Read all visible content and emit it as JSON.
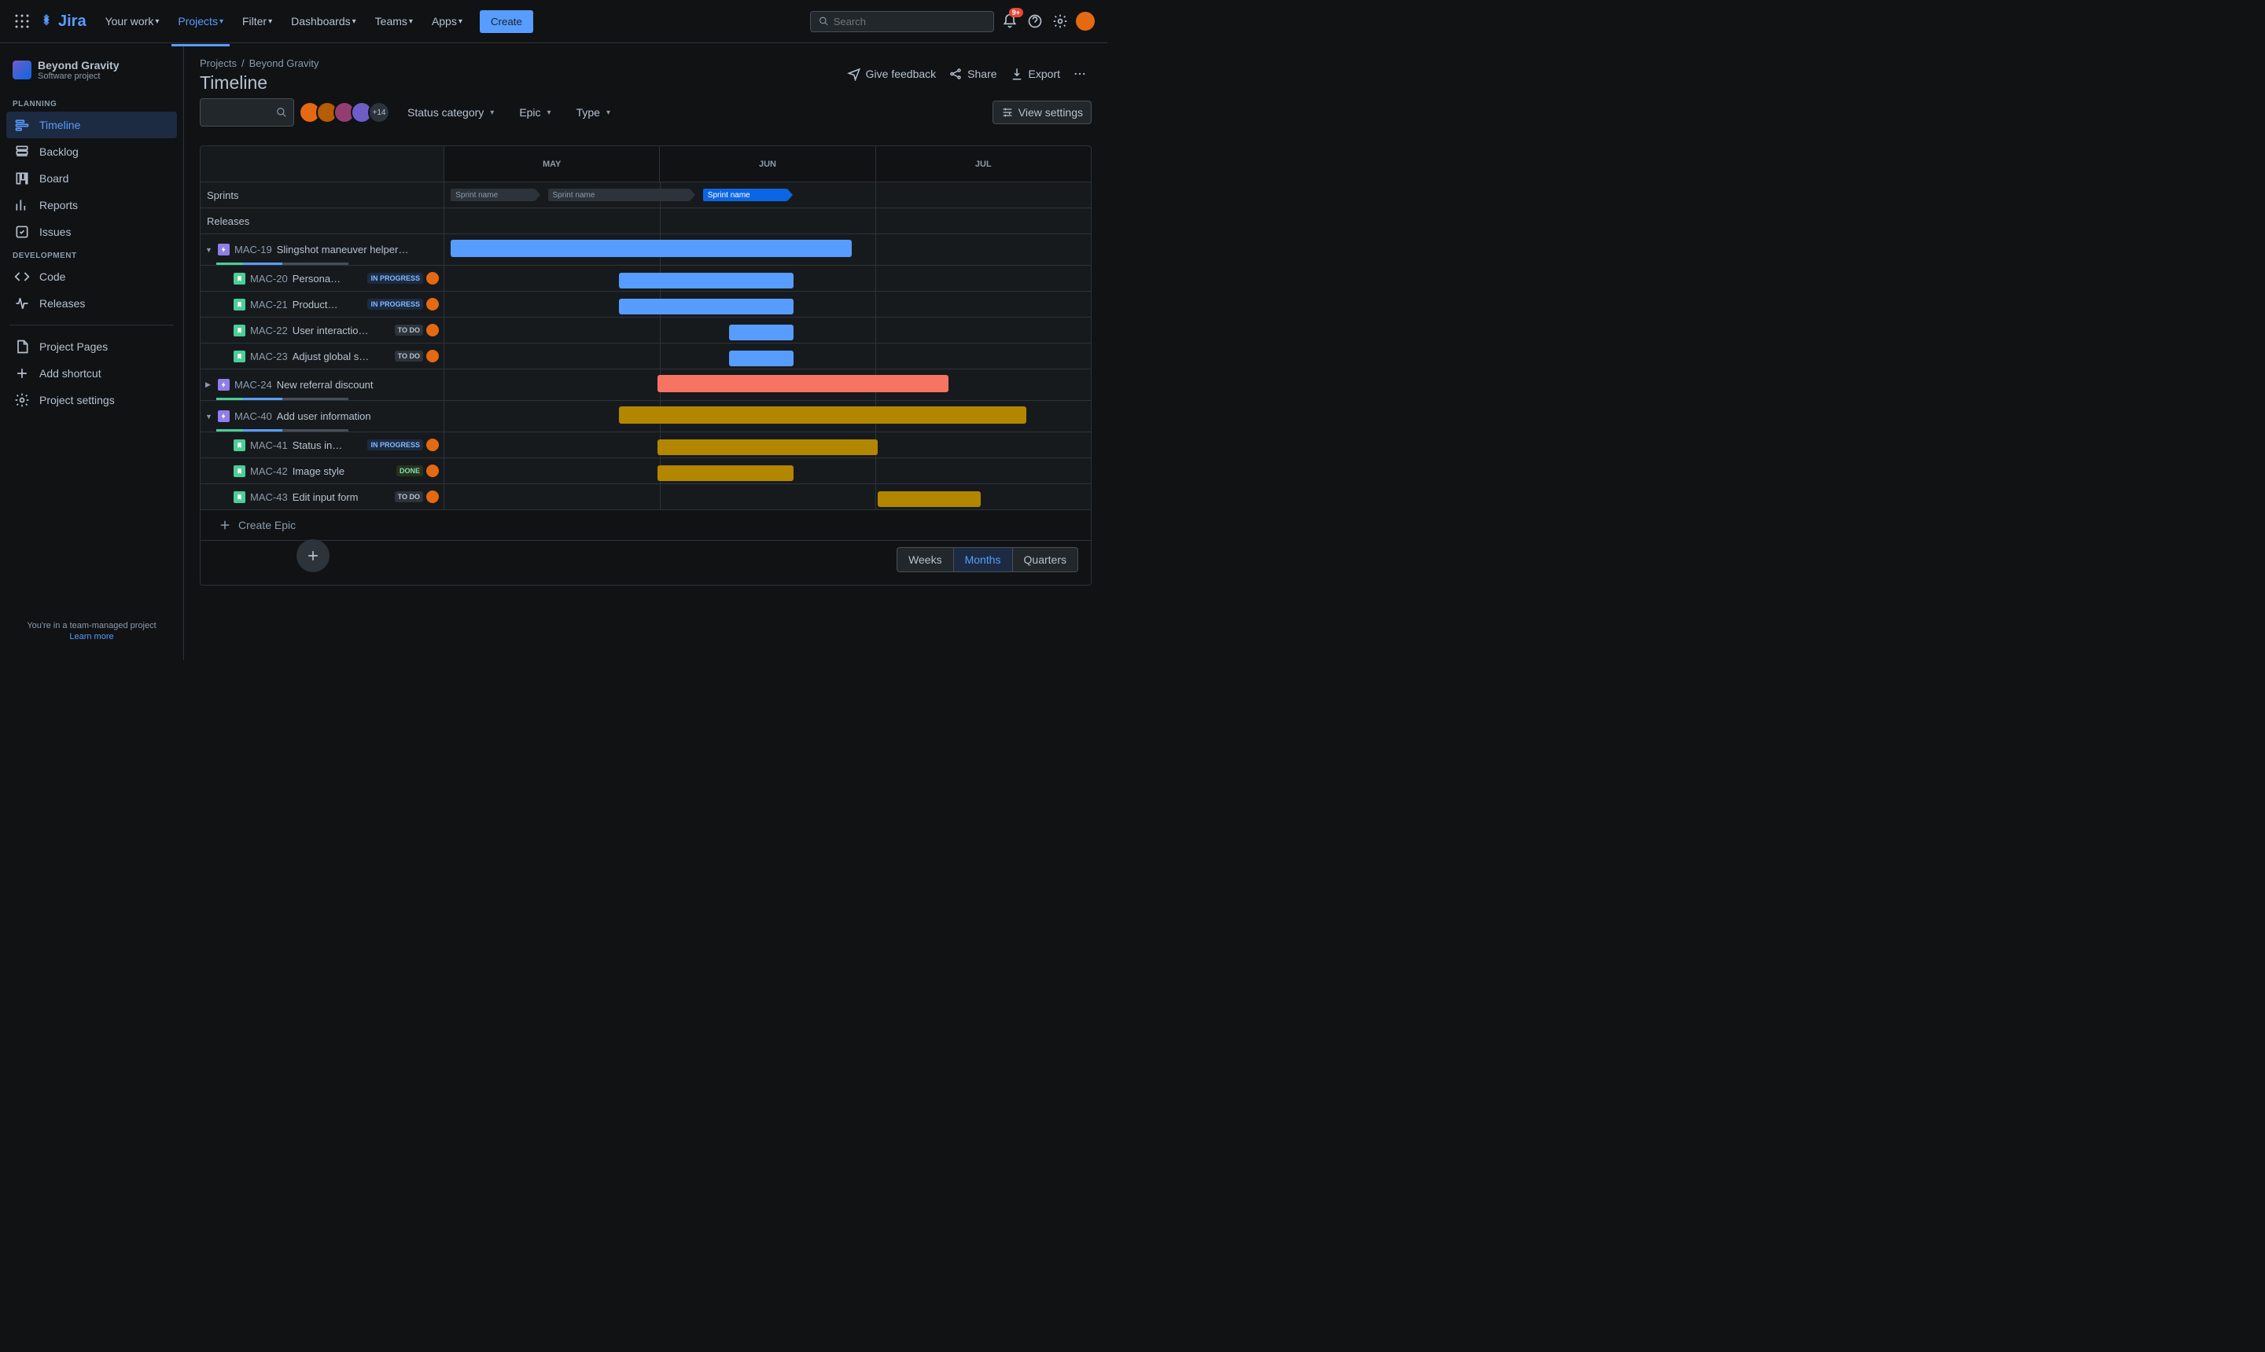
{
  "nav": {
    "items": [
      "Your work",
      "Projects",
      "Filter",
      "Dashboards",
      "Teams",
      "Apps"
    ],
    "create": "Create",
    "search_ph": "Search",
    "notif_badge": "9+"
  },
  "project": {
    "name": "Beyond Gravity",
    "subtitle": "Software project"
  },
  "sidebar": {
    "planning": "PLANNING",
    "planning_items": [
      "Timeline",
      "Backlog",
      "Board",
      "Reports",
      "Issues"
    ],
    "development": "DEVELOPMENT",
    "dev_items": [
      "Code",
      "Releases"
    ],
    "shortcuts": [
      "Project Pages",
      "Add shortcut",
      "Project settings"
    ],
    "footer": "You're in a team-managed project",
    "learn": "Learn more"
  },
  "breadcrumb": [
    "Projects",
    "Beyond Gravity"
  ],
  "title": "Timeline",
  "actions": {
    "feedback": "Give feedback",
    "share": "Share",
    "export": "Export"
  },
  "filters": {
    "status": "Status category",
    "epic": "Epic",
    "type": "Type",
    "more": "+14",
    "view": "View settings"
  },
  "months": [
    "MAY",
    "JUN",
    "JUL"
  ],
  "rows": {
    "sprints": "Sprints",
    "releases": "Releases"
  },
  "sprint_label": "Sprint name",
  "epics": [
    {
      "key": "MAC-19",
      "summary": "Slingshot maneuver helper…",
      "color": "b-blue",
      "barL": 1,
      "barW": 62,
      "children": [
        {
          "key": "MAC-20",
          "sum": "Persona…",
          "status": "IN PROGRESS",
          "st": "st-inprogress",
          "barL": 27,
          "barW": 27
        },
        {
          "key": "MAC-21",
          "sum": "Product…",
          "status": "IN PROGRESS",
          "st": "st-inprogress",
          "barL": 27,
          "barW": 27
        },
        {
          "key": "MAC-22",
          "sum": "User interactio…",
          "status": "TO DO",
          "st": "st-todo",
          "barL": 44,
          "barW": 10
        },
        {
          "key": "MAC-23",
          "sum": "Adjust global s…",
          "status": "TO DO",
          "st": "st-todo",
          "barL": 44,
          "barW": 10
        }
      ]
    },
    {
      "key": "MAC-24",
      "summary": "New referral discount",
      "color": "b-red",
      "barL": 33,
      "barW": 45,
      "collapsed": true
    },
    {
      "key": "MAC-40",
      "summary": "Add user information",
      "color": "b-yellow",
      "barL": 27,
      "barW": 63,
      "children": [
        {
          "key": "MAC-41",
          "sum": "Status in…",
          "status": "IN PROGRESS",
          "st": "st-inprogress",
          "barL": 33,
          "barW": 34,
          "c": "b-yellow"
        },
        {
          "key": "MAC-42",
          "sum": "Image style",
          "status": "DONE",
          "st": "st-done",
          "barL": 33,
          "barW": 21,
          "c": "b-yellow"
        },
        {
          "key": "MAC-43",
          "sum": "Edit input form",
          "status": "TO DO",
          "st": "st-todo",
          "barL": 67,
          "barW": 16,
          "c": "b-yellow"
        }
      ]
    }
  ],
  "create_epic": "Create Epic",
  "zoom": [
    "Weeks",
    "Months",
    "Quarters"
  ]
}
